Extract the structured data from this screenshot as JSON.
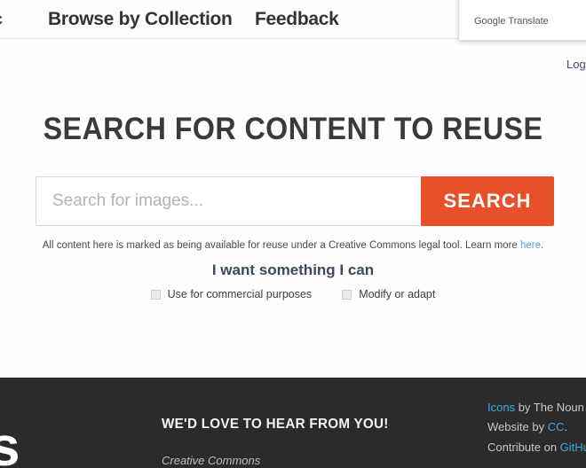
{
  "navbar": {
    "clipped_item": "c",
    "items": [
      {
        "label": "Browse by Collection"
      },
      {
        "label": "Feedback"
      }
    ]
  },
  "translate_popup": {
    "label": "Google Translate"
  },
  "main": {
    "login_link": "Login",
    "title": "SEARCH FOR CONTENT TO REUSE",
    "search": {
      "value": "",
      "placeholder": "Search for images...",
      "button_label": "SEARCH"
    },
    "reuse_note": {
      "text": "All content here is marked as being available for reuse under a Creative Commons legal tool. Learn more ",
      "link_label": "here",
      "trailing": "."
    },
    "filters": {
      "heading": "I want something I can",
      "options": [
        {
          "label": "Use for commercial purposes",
          "checked": false
        },
        {
          "label": "Modify or adapt",
          "checked": false
        }
      ]
    }
  },
  "footer": {
    "logo_fragment": "s",
    "heading": "WE'D LOVE TO HEAR FROM YOU!",
    "address_line1": "Creative Commons",
    "address_line2": "",
    "credits": {
      "line1_link": "Icons",
      "line1_rest": " by The Noun P",
      "line2_pre": "Website by ",
      "line2_link": "CC",
      "line2_post": ".",
      "line3_pre": "Contribute on ",
      "line3_link": "GitHu"
    }
  },
  "colors": {
    "accent_orange": "#e8502a",
    "link_blue": "#3daadb",
    "footer_bg": "#2b2b2b",
    "heading_text": "#3a3a3a"
  }
}
